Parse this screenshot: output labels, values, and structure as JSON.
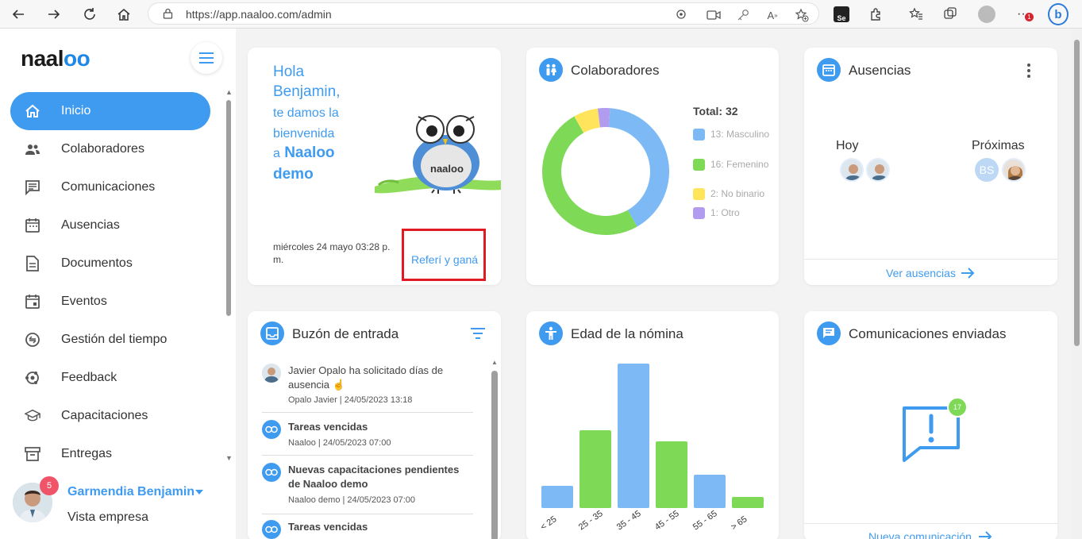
{
  "browser": {
    "url": "https://app.naaloo.com/admin",
    "profile_badge": "1"
  },
  "sidebar": {
    "logo_prefix": "naal",
    "logo_suffix": "oo",
    "items": [
      {
        "label": "Inicio",
        "icon": "home-icon"
      },
      {
        "label": "Colaboradores",
        "icon": "people-icon"
      },
      {
        "label": "Comunicaciones",
        "icon": "message-icon"
      },
      {
        "label": "Ausencias",
        "icon": "calendar-icon"
      },
      {
        "label": "Documentos",
        "icon": "document-icon"
      },
      {
        "label": "Eventos",
        "icon": "event-icon"
      },
      {
        "label": "Gestión del tiempo",
        "icon": "time-icon"
      },
      {
        "label": "Feedback",
        "icon": "feedback-icon"
      },
      {
        "label": "Capacitaciones",
        "icon": "school-icon"
      },
      {
        "label": "Entregas",
        "icon": "archive-icon"
      }
    ],
    "user": {
      "name": "Garmendia Benjamin",
      "role": "Vista empresa",
      "badge": "5"
    }
  },
  "welcome": {
    "line1": "Hola",
    "line2": "Benjamin,",
    "line3": "te damos la bienvenida",
    "line4_prefix": "a",
    "line4_name": "Naaloo",
    "line5": "demo",
    "owl_text": "naaloo",
    "date": "miércoles 24 mayo 03:28 p. m.",
    "refer_link": "Referí y ganá"
  },
  "colaboradores": {
    "title": "Colaboradores",
    "total": "Total: 32",
    "legend": [
      {
        "label": "13: Masculino",
        "color": "#7cb9f5"
      },
      {
        "label": "16: Femenino",
        "color": "#7ed957"
      },
      {
        "label": "2: No binario",
        "color": "#ffe45c"
      },
      {
        "label": "1: Otro",
        "color": "#b19cf0"
      }
    ]
  },
  "ausencias": {
    "title": "Ausencias",
    "today_label": "Hoy",
    "upcoming_label": "Próximas",
    "upcoming_initials": "BS",
    "link": "Ver ausencias"
  },
  "inbox": {
    "title": "Buzón de entrada",
    "messages": [
      {
        "title": "Javier Opalo ha solicitado días de ausencia ☝",
        "sub": "Opalo Javier | 24/05/2023 13:18",
        "bold": false
      },
      {
        "title": "Tareas vencidas",
        "sub": "Naaloo | 24/05/2023 07:00",
        "bold": true
      },
      {
        "title": "Nuevas capacitaciones pendientes de Naaloo demo",
        "sub": "Naaloo demo | 24/05/2023 07:00",
        "bold": true
      },
      {
        "title": "Tareas vencidas",
        "sub": "",
        "bold": true
      }
    ]
  },
  "edad": {
    "title": "Edad de la nómina"
  },
  "comunicaciones": {
    "title": "Comunicaciones enviadas",
    "count": "17",
    "link": "Nueva comunicación"
  },
  "chart_data": [
    {
      "type": "pie",
      "title": "Colaboradores",
      "categories": [
        "Masculino",
        "Femenino",
        "No binario",
        "Otro"
      ],
      "values": [
        13,
        16,
        2,
        1
      ],
      "colors": [
        "#7cb9f5",
        "#7ed957",
        "#ffe45c",
        "#b19cf0"
      ]
    },
    {
      "type": "bar",
      "title": "Edad de la nómina",
      "categories": [
        "< 25",
        "25 - 35",
        "35 - 45",
        "45 - 55",
        "55 - 65",
        "> 65"
      ],
      "values": [
        2,
        7,
        13,
        6,
        3,
        1
      ],
      "colors": [
        "#7cb9f5",
        "#7ed957",
        "#7cb9f5",
        "#7ed957",
        "#7cb9f5",
        "#7ed957"
      ],
      "ylim": [
        0,
        13
      ]
    }
  ]
}
